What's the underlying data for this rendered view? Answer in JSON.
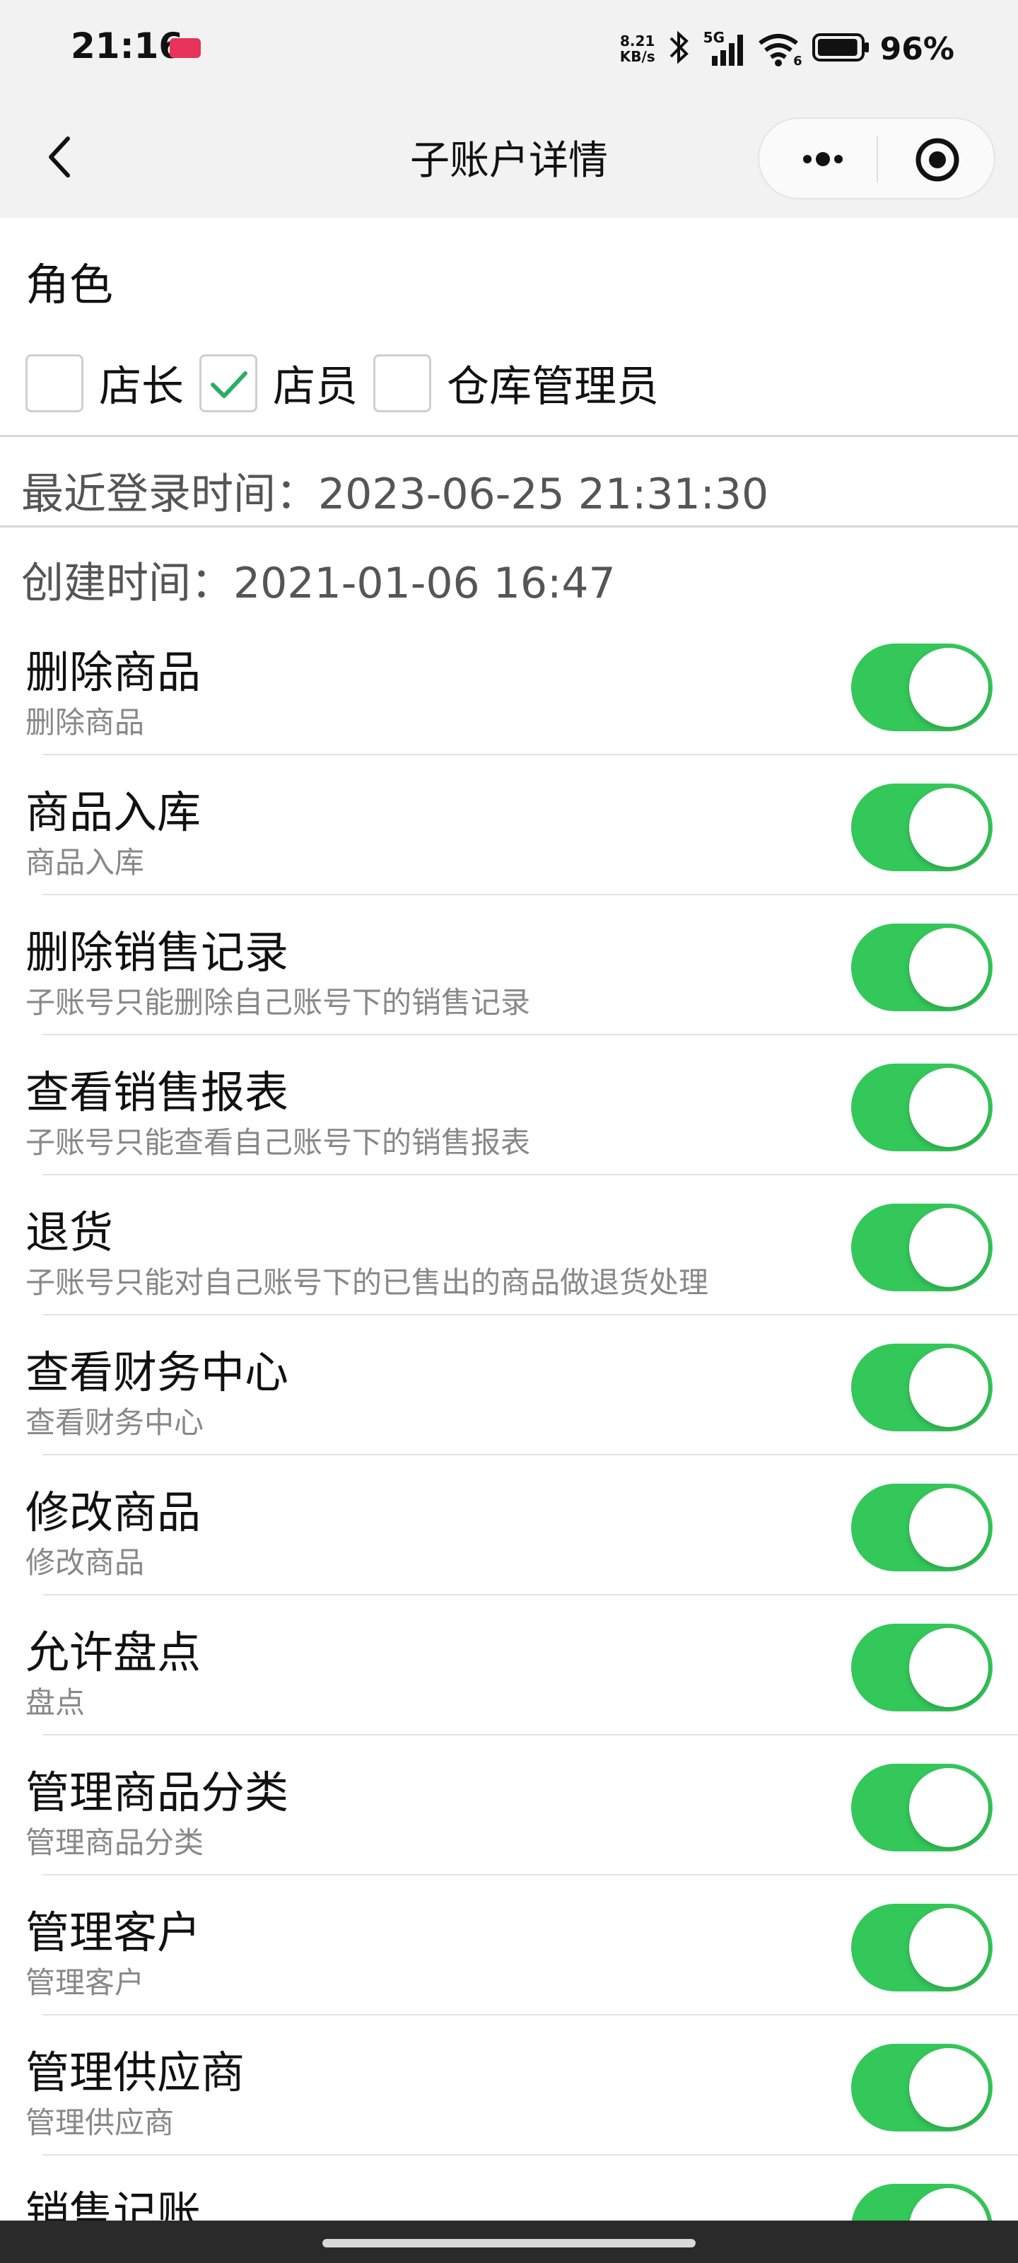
{
  "status_bar": {
    "time": "21:16",
    "net_speed_value": "8.21",
    "net_speed_unit": "KB/s",
    "network_type": "5G",
    "wifi_badge": "6",
    "battery_percent": "96%",
    "battery_level": 0.96,
    "icons": [
      "screen-record-icon",
      "bluetooth-icon",
      "signal-icon",
      "wifi-icon",
      "battery-icon"
    ]
  },
  "nav": {
    "title": "子账户详情",
    "icons": [
      "back-arrow-icon",
      "more-dots-icon",
      "close-target-icon"
    ]
  },
  "role": {
    "heading": "角色",
    "options": [
      {
        "label": "店长",
        "checked": false
      },
      {
        "label": "店员",
        "checked": true
      },
      {
        "label": "仓库管理员",
        "checked": false
      }
    ],
    "check_color": "#2aae67"
  },
  "info": {
    "last_login": "最近登录时间：2023-06-25 21:31:30",
    "created": "创建时间：2021-01-06 16:47"
  },
  "permissions": [
    {
      "title": "删除商品",
      "desc": "删除商品",
      "enabled": true
    },
    {
      "title": "商品入库",
      "desc": "商品入库",
      "enabled": true
    },
    {
      "title": "删除销售记录",
      "desc": "子账号只能删除自己账号下的销售记录",
      "enabled": true
    },
    {
      "title": "查看销售报表",
      "desc": "子账号只能查看自己账号下的销售报表",
      "enabled": true
    },
    {
      "title": "退货",
      "desc": "子账号只能对自己账号下的已售出的商品做退货处理",
      "enabled": true
    },
    {
      "title": "查看财务中心",
      "desc": "查看财务中心",
      "enabled": true
    },
    {
      "title": "修改商品",
      "desc": "修改商品",
      "enabled": true
    },
    {
      "title": "允许盘点",
      "desc": "盘点",
      "enabled": true
    },
    {
      "title": "管理商品分类",
      "desc": "管理商品分类",
      "enabled": true
    },
    {
      "title": "管理客户",
      "desc": "管理客户",
      "enabled": true
    },
    {
      "title": "管理供应商",
      "desc": "管理供应商",
      "enabled": true
    },
    {
      "title": "销售记账",
      "desc": "",
      "enabled": true
    }
  ],
  "colors": {
    "toggle_on": "#34c759",
    "header_bg": "#f2f2f2",
    "record_icon": "#e8335a"
  }
}
